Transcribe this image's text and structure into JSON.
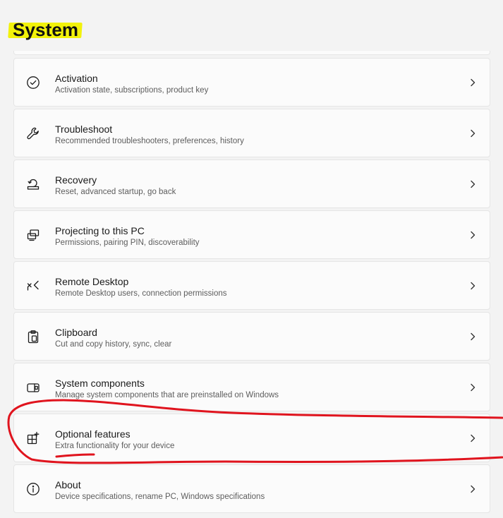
{
  "header": {
    "title": "System"
  },
  "items": [
    {
      "title": "Activation",
      "subtitle": "Activation state, subscriptions, product key",
      "icon": "activation-check-icon"
    },
    {
      "title": "Troubleshoot",
      "subtitle": "Recommended troubleshooters, preferences, history",
      "icon": "wrench-icon"
    },
    {
      "title": "Recovery",
      "subtitle": "Reset, advanced startup, go back",
      "icon": "recovery-icon"
    },
    {
      "title": "Projecting to this PC",
      "subtitle": "Permissions, pairing PIN, discoverability",
      "icon": "projecting-icon"
    },
    {
      "title": "Remote Desktop",
      "subtitle": "Remote Desktop users, connection permissions",
      "icon": "remote-desktop-icon"
    },
    {
      "title": "Clipboard",
      "subtitle": "Cut and copy history, sync, clear",
      "icon": "clipboard-icon"
    },
    {
      "title": "System components",
      "subtitle": "Manage system components that are preinstalled on Windows",
      "icon": "system-components-icon"
    },
    {
      "title": "Optional features",
      "subtitle": "Extra functionality for your device",
      "icon": "optional-features-icon"
    },
    {
      "title": "About",
      "subtitle": "Device specifications, rename PC, Windows specifications",
      "icon": "info-icon"
    }
  ],
  "colors": {
    "title_highlight": "#f2f20a",
    "annotation": "#e0141e",
    "card_background": "#fbfbfb",
    "page_background": "#f3f3f3"
  }
}
